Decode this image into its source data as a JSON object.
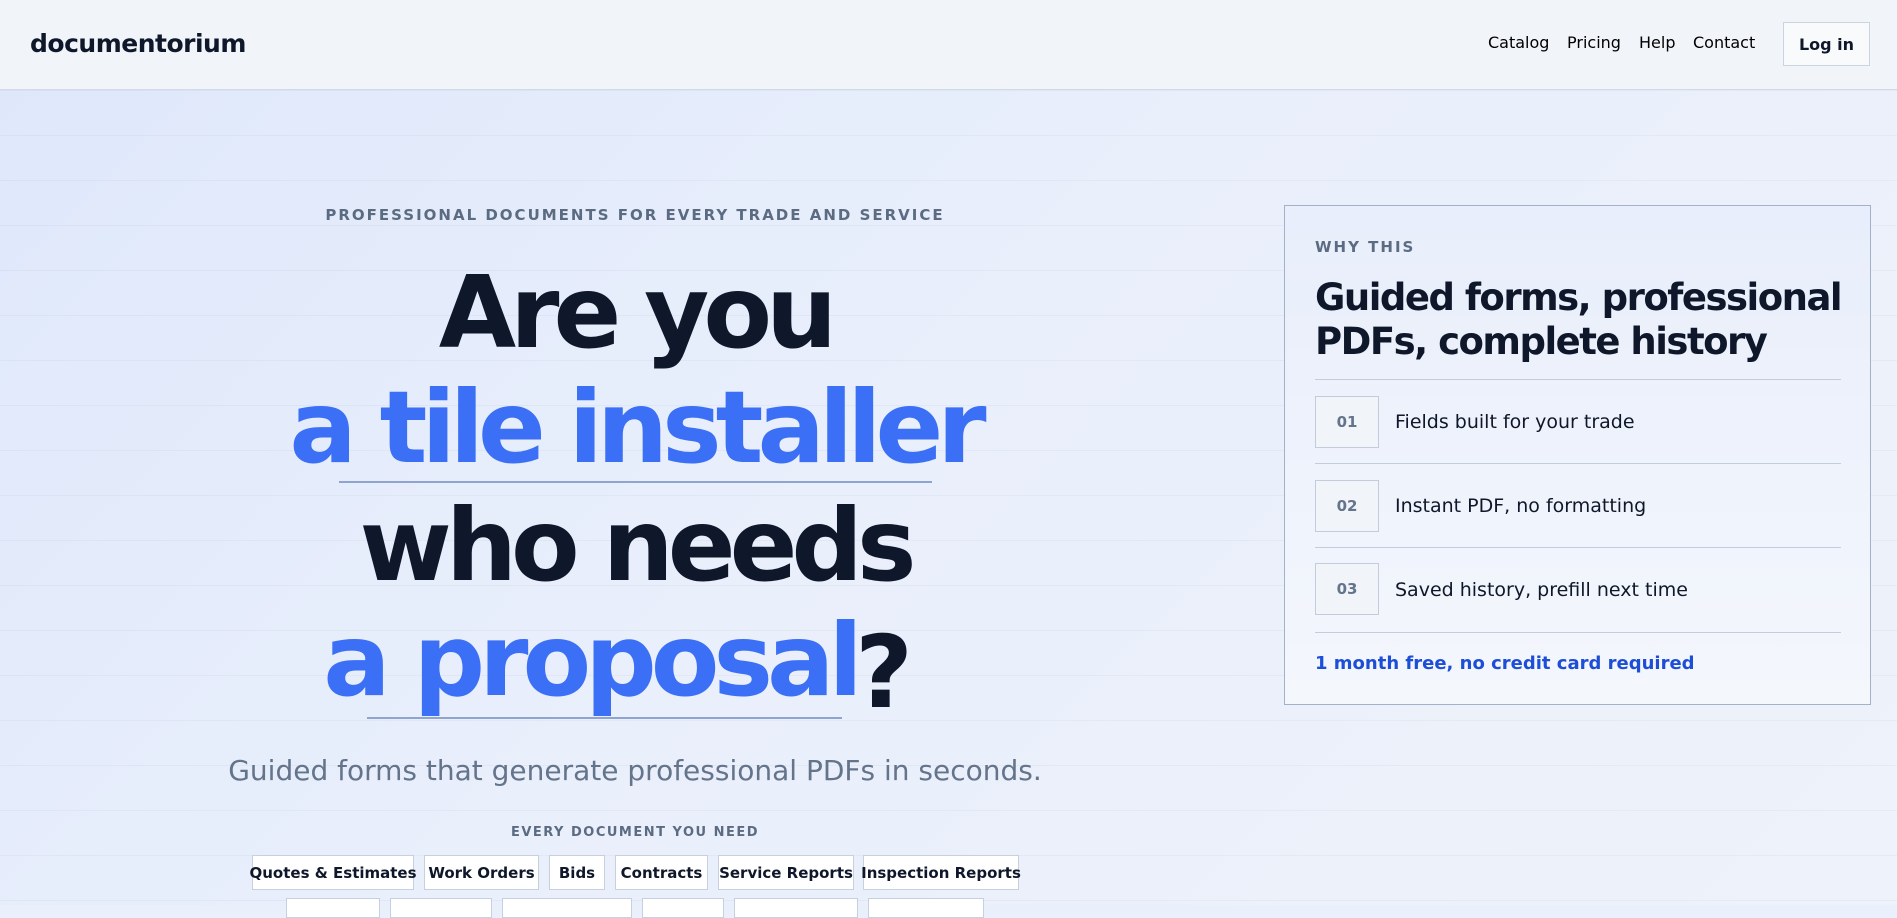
{
  "header": {
    "logo": "documentorium",
    "nav": [
      "Catalog",
      "Pricing",
      "Help",
      "Contact"
    ],
    "login_label": "Log in"
  },
  "hero": {
    "eyebrow": "PROFESSIONAL DOCUMENTS FOR EVERY TRADE AND SERVICE",
    "line1": "Are you",
    "trade": "a tile installer",
    "line3": "who needs",
    "document": "a proposal",
    "question_mark": "?",
    "subtitle": "Guided forms that generate professional PDFs in seconds.",
    "documents_label": "EVERY DOCUMENT YOU NEED",
    "documents": [
      "Quotes & Estimates",
      "Work Orders",
      "Bids",
      "Contracts",
      "Service Reports",
      "Inspection Reports"
    ]
  },
  "why_card": {
    "eyebrow": "WHY THIS",
    "title": "Guided forms, professional PDFs, complete history",
    "features": [
      {
        "num": "01",
        "text": "Fields built for your trade"
      },
      {
        "num": "02",
        "text": "Instant PDF, no formatting"
      },
      {
        "num": "03",
        "text": "Saved history, prefill next time"
      }
    ],
    "cta": "1 month free, no credit card required"
  },
  "colors": {
    "accent": "#3b6ff5",
    "heading": "#0f172a",
    "cta_link": "#1d4ed8"
  }
}
